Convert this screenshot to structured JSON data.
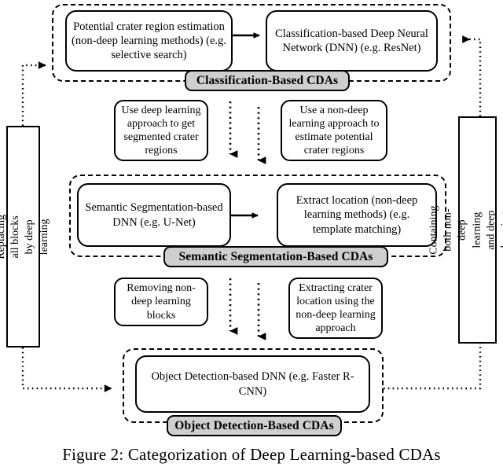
{
  "figure": {
    "caption": "Figure 2: Categorization of Deep Learning-based CDAs"
  },
  "groups": [
    {
      "id": "classification",
      "pill_label": "Classification-Based CDAs",
      "nodes": [
        {
          "id": "potential-crater-region-estimation",
          "text": "Potential crater region estimation (non-deep learning methods) (e.g. selective search)"
        },
        {
          "id": "classification-dnn",
          "text": "Classification-based Deep Neural Network (DNN) (e.g. ResNet)"
        }
      ]
    },
    {
      "id": "semantic-segmentation",
      "pill_label": "Semantic Segmentation-Based CDAs",
      "nodes": [
        {
          "id": "semantic-segmentation-dnn",
          "text": "Semantic Segmentation-based DNN (e.g. U-Net)"
        },
        {
          "id": "extract-location",
          "text": "Extract location (non-deep learning methods) (e.g. template matching)"
        }
      ]
    },
    {
      "id": "object-detection",
      "pill_label": "Object Detection-Based CDAs",
      "nodes": [
        {
          "id": "object-detection-dnn",
          "text": "Object Detection-based DNN (e.g. Faster R-CNN)"
        }
      ]
    }
  ],
  "transitions": {
    "upper_left": "Use deep learning approach to get segmented crater regions",
    "upper_right": "Use a non-deep learning approach to estimate potential crater regions",
    "lower_left": "Removing non-deep learning blocks",
    "lower_right": "Extracting crater location using the non-deep learning approach"
  },
  "side_boxes": {
    "left": "Replacing all blocks by deep learning",
    "right": "Containing both non-deep learning and deep learning modules"
  },
  "colors": {
    "pill_fill": "#cfcfcf",
    "stroke": "#000000",
    "background": "#ffffff"
  }
}
